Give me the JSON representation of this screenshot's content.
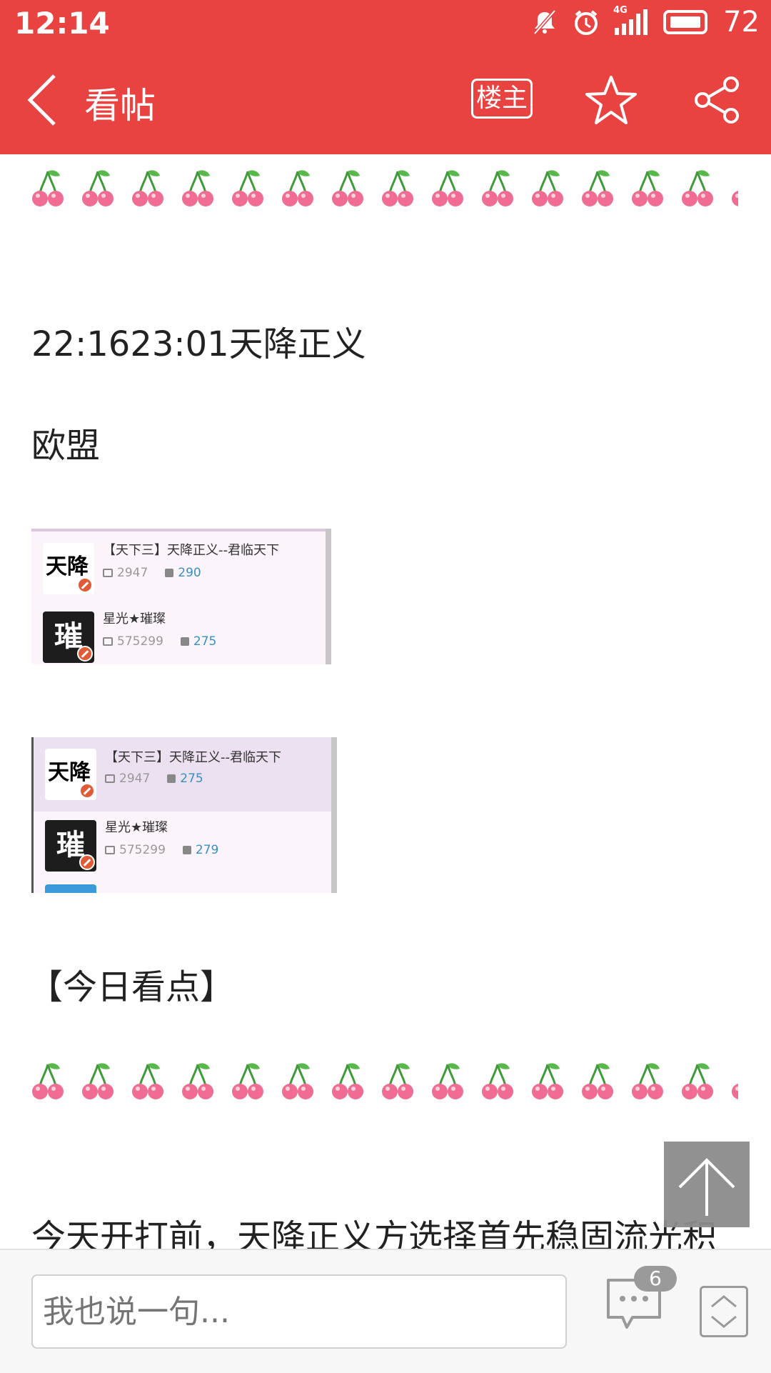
{
  "status_bar": {
    "time": "12:14",
    "network": "4G",
    "battery": "72",
    "icons": [
      "mute-icon",
      "alarm-icon",
      "signal-icon",
      "battery-icon"
    ]
  },
  "app_bar": {
    "title": "看帖",
    "op_label": "楼主",
    "background": "#e84341"
  },
  "post": {
    "line1": "22:1623:01天降正义",
    "line2": "欧盟",
    "screenshot1": {
      "rows": [
        {
          "name": "【天下三】天降正义--君临天下",
          "id": "2947",
          "count": "290",
          "avatar_text": "天降"
        },
        {
          "name": "星光★璀璨",
          "id": "575299",
          "count": "275",
          "avatar_text": "璀"
        }
      ]
    },
    "screenshot2": {
      "rows": [
        {
          "name": "【天下三】天降正义--君临天下",
          "id": "2947",
          "count": "275",
          "avatar_text": "天降"
        },
        {
          "name": "星光★璀璨",
          "id": "575299",
          "count": "279",
          "avatar_text": "璀"
        }
      ]
    },
    "section_title": "【今日看点】",
    "line3": "今天开打前，天降正义方选择首先稳固流光积"
  },
  "bottom_bar": {
    "placeholder": "我也说一句...",
    "comment_count": "6"
  }
}
